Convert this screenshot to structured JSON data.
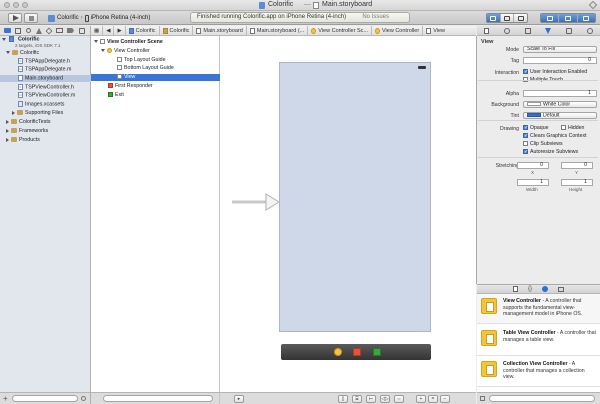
{
  "window": {
    "title_project": "Colorific",
    "title_file": "Main.storyboard"
  },
  "toolbar": {
    "scheme": "Colorific",
    "destination": "iPhone Retina (4-inch)",
    "activity_text": "Finished running Colorific.app on iPhone Retina (4-inch)",
    "issues_text": "No Issues"
  },
  "jumpbar": {
    "crumbs": [
      "Colorific",
      "Colorific",
      "Main.storyboard",
      "Main.storyboard (...",
      "View Controller Sc...",
      "View Controller",
      "View"
    ]
  },
  "navigator": {
    "project": "Colorific",
    "project_sub": "2 targets, iOS SDK 7.1",
    "items": [
      {
        "label": "Colorific"
      },
      {
        "label": "TSPAppDelegate.h"
      },
      {
        "label": "TSPAppDelegate.m"
      },
      {
        "label": "Main.storyboard"
      },
      {
        "label": "TSPViewController.h"
      },
      {
        "label": "TSPViewController.m"
      },
      {
        "label": "Images.xcassets"
      },
      {
        "label": "Supporting Files"
      },
      {
        "label": "ColorificTests"
      },
      {
        "label": "Frameworks"
      },
      {
        "label": "Products"
      }
    ]
  },
  "outline": {
    "scene": "View Controller Scene",
    "vc": "View Controller",
    "top_guide": "Top Layout Guide",
    "bottom_guide": "Bottom Layout Guide",
    "view": "View",
    "first_responder": "First Responder",
    "exit": "Exit"
  },
  "inspector": {
    "section": "View",
    "mode_label": "Mode",
    "mode_value": "Scale To Fill",
    "tag_label": "Tag",
    "tag_value": "0",
    "interaction_label": "Interaction",
    "user_interaction": "User Interaction Enabled",
    "multiple_touch": "Multiple Touch",
    "alpha_label": "Alpha",
    "alpha_value": "1",
    "background_label": "Background",
    "background_value": "White Color",
    "tint_label": "Tint",
    "tint_value": "Default",
    "drawing_label": "Drawing",
    "opaque": "Opaque",
    "hidden": "Hidden",
    "clears": "Clears Graphics Context",
    "clip": "Clip Subviews",
    "autoresize": "Autoresize Subviews",
    "stretching_label": "Stretching",
    "stretch_x": "0",
    "stretch_y": "0",
    "stretch_w": "1",
    "stretch_h": "1",
    "x_label": "X",
    "y_label": "Y",
    "w_label": "Width",
    "h_label": "Height"
  },
  "library": {
    "items": [
      {
        "title": "View Controller",
        "desc": " - A controller that supports the fundamental view-management model in iPhone OS."
      },
      {
        "title": "Table View Controller",
        "desc": " - A controller that manages a table view."
      },
      {
        "title": "Collection View Controller",
        "desc": " - A controller that manages a collection view."
      }
    ]
  },
  "colors": {
    "selection": "#3875d7",
    "nav_selection": "#b8c7de",
    "device": "#ced8e8",
    "tint": "#2f6fd0",
    "accent_folder": "#c5a25a"
  }
}
